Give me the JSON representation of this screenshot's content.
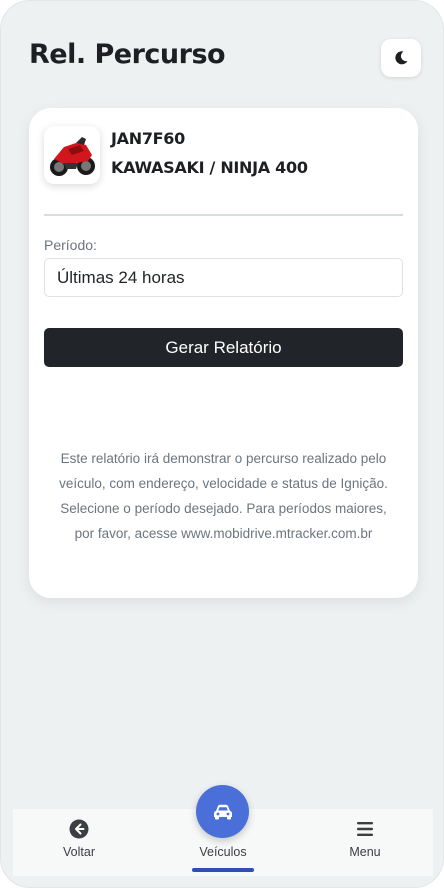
{
  "header": {
    "title": "Rel. Percurso",
    "theme_toggle_icon": "moon-icon"
  },
  "vehicle": {
    "image_icon": "motorcycle-image",
    "plate": "JAN7F60",
    "model": "KAWASAKI / NINJA 400"
  },
  "form": {
    "period_label": "Período:",
    "period_value": "Últimas 24 horas",
    "generate_label": "Gerar Relatório"
  },
  "info": {
    "text": "Este relatório irá demonstrar o percurso realizado pelo veículo, com endereço, velocidade e status de Ignição. Selecione o período desejado. Para períodos maiores, por favor, acesse www.mobidrive.mtracker.com.br"
  },
  "bottom_nav": {
    "back": {
      "label": "Voltar",
      "icon": "arrow-left-circle-icon"
    },
    "vehicles": {
      "label": "Veículos",
      "icon": "car-icon"
    },
    "menu": {
      "label": "Menu",
      "icon": "hamburger-menu-icon"
    }
  },
  "colors": {
    "background": "#eef1f1",
    "primary_dark": "#212529",
    "fab_blue": "#4a6fd8",
    "active_indicator": "#2e4fb8"
  }
}
